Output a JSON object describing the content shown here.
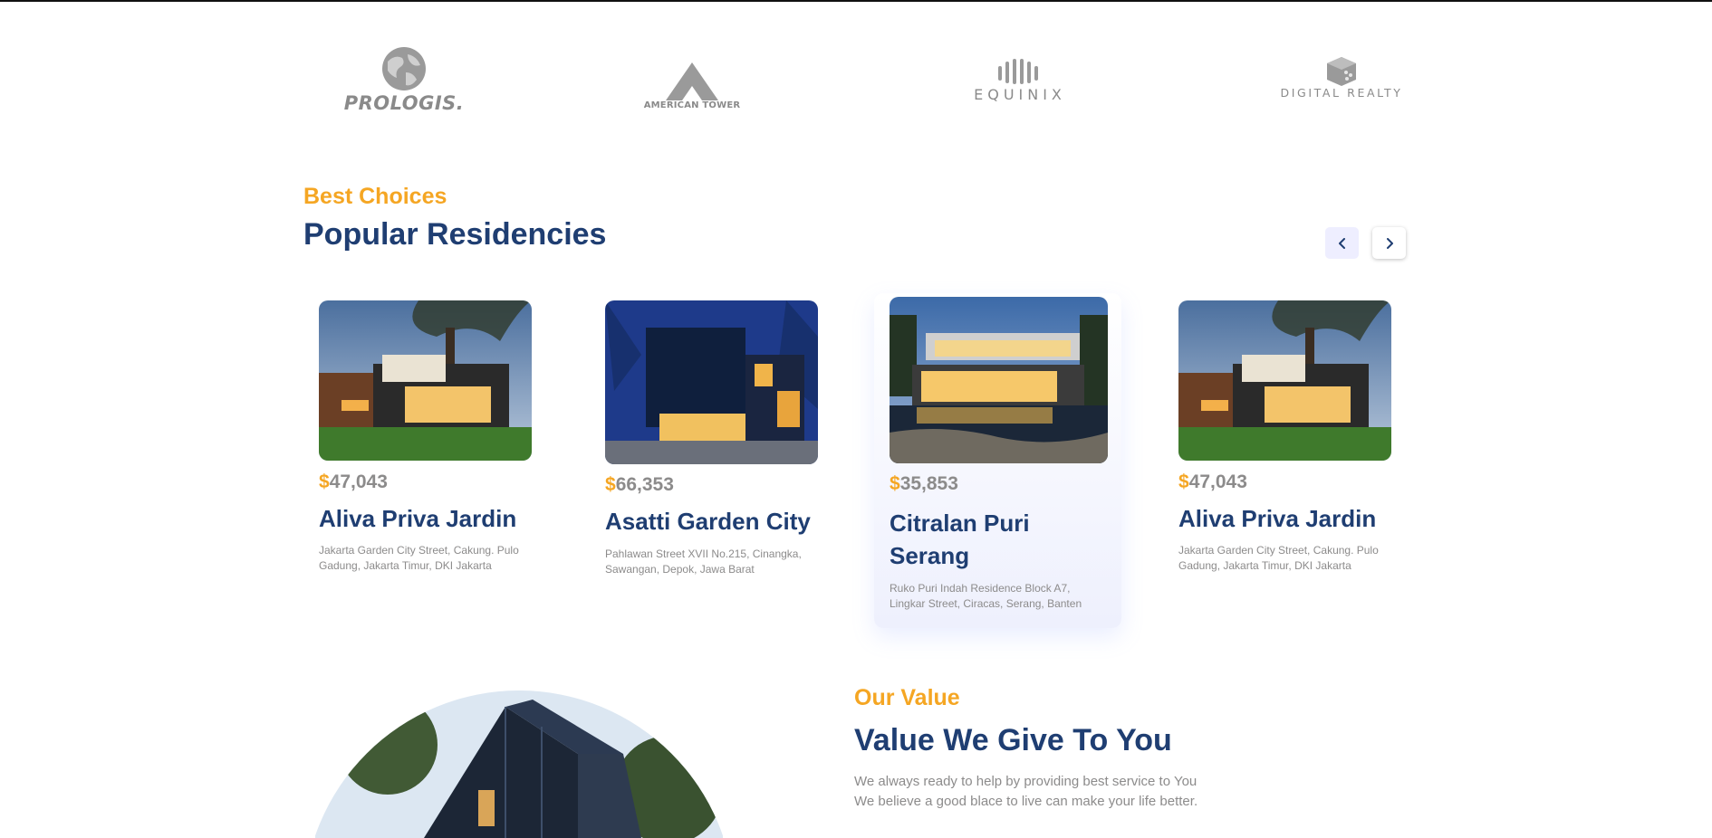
{
  "brands": [
    {
      "name": "PROLOGIS.",
      "icon": "globe-icon"
    },
    {
      "name": "AMERICAN TOWER",
      "icon": "tower-a-icon"
    },
    {
      "name": "EQUINIX",
      "icon": "equinix-bars-icon"
    },
    {
      "name": "DIGITAL REALTY",
      "icon": "cube-icon"
    }
  ],
  "residencies": {
    "eyebrow": "Best Choices",
    "title": "Popular Residencies",
    "prev_icon": "chevron-left-icon",
    "next_icon": "chevron-right-icon",
    "currency": "$",
    "cards": [
      {
        "price": "47,043",
        "name": "Aliva Priva Jardin",
        "address": "Jakarta Garden City Street, Cakung. Pulo Gadung, Jakarta Timur, DKI Jakarta"
      },
      {
        "price": "66,353",
        "name": "Asatti Garden City",
        "address": "Pahlawan Street XVII No.215, Cinangka, Sawangan, Depok, Jawa Barat"
      },
      {
        "price": "35,853",
        "name": "Citralan Puri Serang",
        "address": "Ruko Puri Indah Residence Block A7, Lingkar Street, Ciracas, Serang, Banten"
      },
      {
        "price": "47,043",
        "name": "Aliva Priva Jardin",
        "address": "Jakarta Garden City Street, Cakung. Pulo Gadung, Jakarta Timur, DKI Jakarta"
      }
    ]
  },
  "value": {
    "eyebrow": "Our Value",
    "title": "Value We Give To You",
    "lines": [
      "We always ready to help by providing best service to You",
      "We believe a good blace to live can make your life better."
    ]
  },
  "colors": {
    "accent": "#f5a623",
    "navy": "#1f3e72",
    "gray": "#8c8b8b",
    "active_card_tint": "#eef0fd"
  }
}
